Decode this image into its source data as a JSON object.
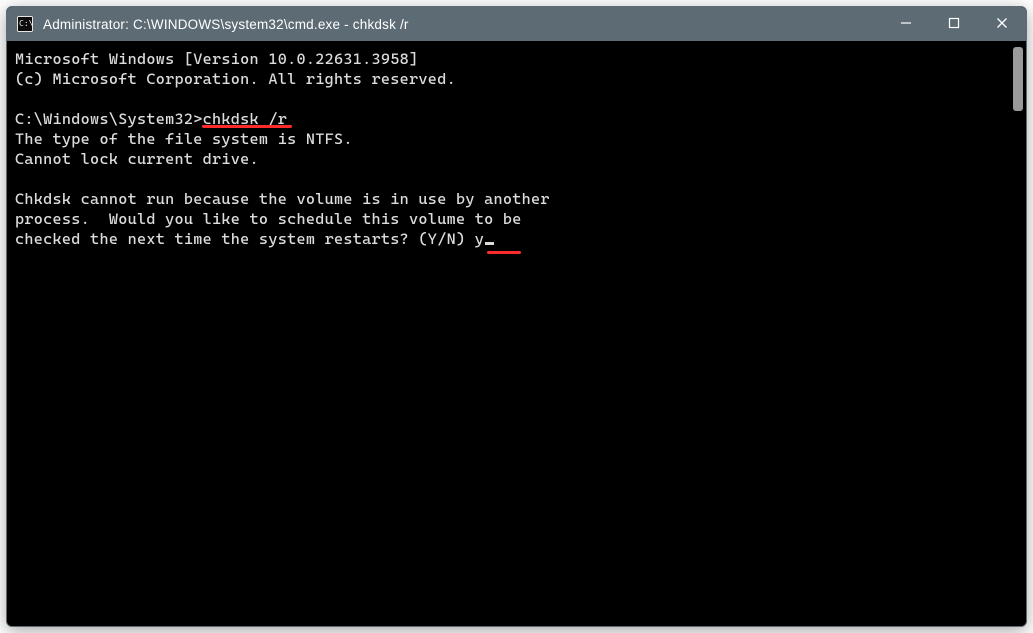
{
  "titlebar": {
    "title": "Administrator: C:\\WINDOWS\\system32\\cmd.exe - chkdsk  /r"
  },
  "terminal": {
    "line_version": "Microsoft Windows [Version 10.0.22631.3958]",
    "line_copyright": "(c) Microsoft Corporation. All rights reserved.",
    "prompt_path": "C:\\Windows\\System32>",
    "command": "chkdsk /r",
    "out_fs_type": "The type of the file system is NTFS.",
    "out_lock": "Cannot lock current drive.",
    "out_sched_1": "Chkdsk cannot run because the volume is in use by another",
    "out_sched_2": "process.  Would you like to schedule this volume to be",
    "out_sched_3": "checked the next time the system restarts? (Y/N) ",
    "user_answer": "y"
  },
  "annotations": {
    "underline_command_color": "#ff2a2a",
    "underline_answer_color": "#ff2a2a"
  }
}
